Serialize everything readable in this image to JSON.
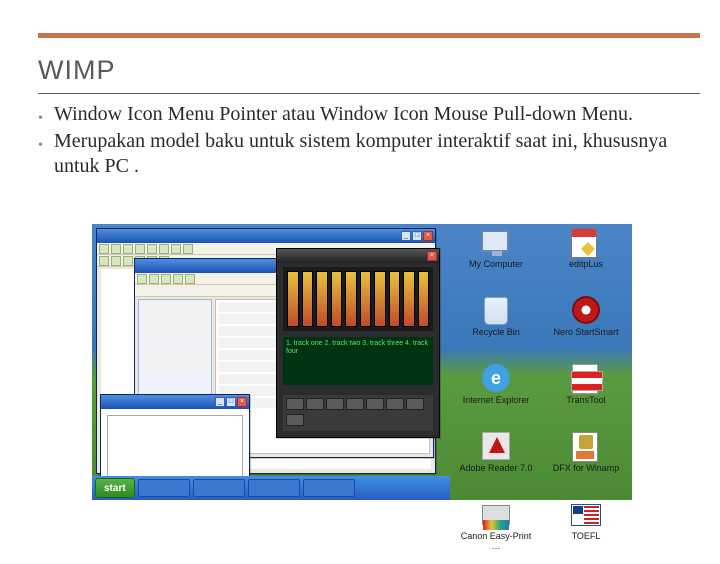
{
  "title": "WIMP",
  "bullets": [
    "Window Icon Menu Pointer atau Window Icon Mouse Pull-down Menu.",
    "Merupakan model baku untuk sistem komputer interaktif saat ini, khususnya untuk PC ."
  ],
  "screenshot": {
    "taskbar": {
      "start_label": "start"
    },
    "media_player": {
      "display_lines": "1. track one\n2. track two\n3. track three\n4. track four"
    },
    "desktop_icons": [
      {
        "name": "my-computer-icon",
        "label": "My Computer",
        "gfx": "ico-monitor"
      },
      {
        "name": "editplus-icon",
        "label": "editpLus",
        "gfx": "ico-edit"
      },
      {
        "name": "recycle-bin-icon",
        "label": "Recycle Bin",
        "gfx": "ico-bin"
      },
      {
        "name": "nero-startsmart-icon",
        "label": "Nero StartSmart",
        "gfx": "ico-nero"
      },
      {
        "name": "internet-explorer-icon",
        "label": "Internet Explorer",
        "gfx": "ico-ie"
      },
      {
        "name": "transtool-icon",
        "label": "TransTool",
        "gfx": "ico-trans"
      },
      {
        "name": "adobe-reader-icon",
        "label": "Adobe Reader 7.0",
        "gfx": "ico-adobe"
      },
      {
        "name": "dfx-winamp-icon",
        "label": "DFX for Winamp",
        "gfx": "ico-dfx"
      },
      {
        "name": "canon-easyprint-icon",
        "label": "Canon Easy-Print …",
        "gfx": "ico-canon"
      },
      {
        "name": "toefl-icon",
        "label": "TOEFL",
        "gfx": "ico-toefl"
      }
    ]
  }
}
